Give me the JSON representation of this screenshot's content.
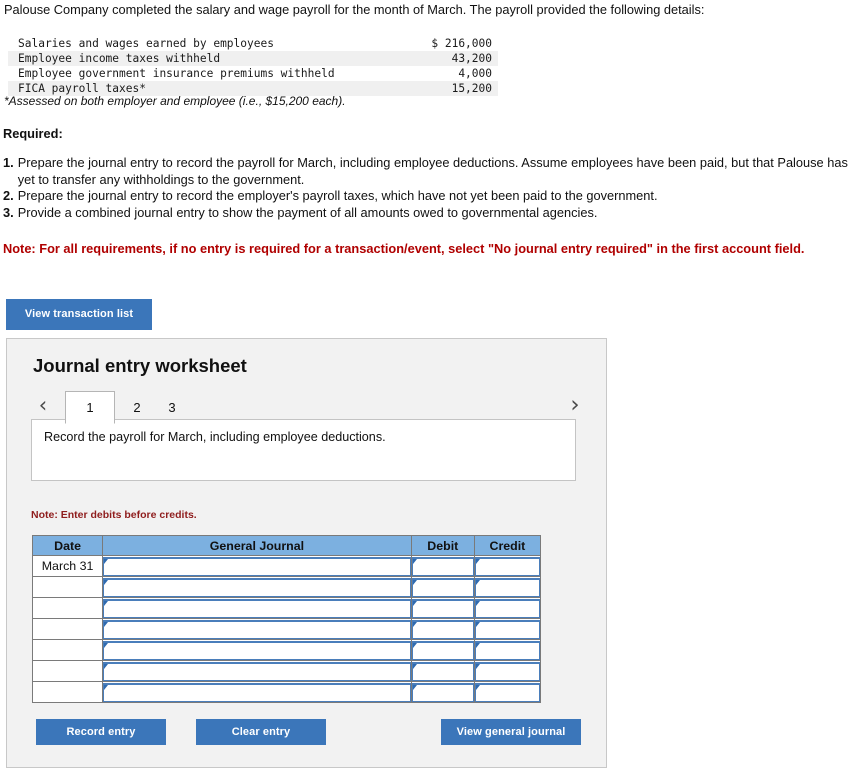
{
  "intro": "Palouse Company completed the salary and wage payroll for the month of March. The payroll provided the following details:",
  "payroll_details": {
    "rows": [
      {
        "label": "Salaries and wages earned by employees",
        "amount": "$ 216,000"
      },
      {
        "label": "Employee income taxes withheld",
        "amount": "43,200"
      },
      {
        "label": "Employee government insurance premiums withheld",
        "amount": "4,000"
      },
      {
        "label": "FICA payroll taxes*",
        "amount": "15,200"
      }
    ],
    "footnote": "*Assessed on both employer and employee (i.e., $15,200 each)."
  },
  "required": {
    "heading": "Required:",
    "items": [
      {
        "num": "1.",
        "text": "Prepare the journal entry to record the payroll for March, including employee deductions. Assume employees have been paid, but that Palouse has yet to transfer any withholdings to the government."
      },
      {
        "num": "2.",
        "text": "Prepare the journal entry to record the employer's payroll taxes, which have not yet been paid to the government."
      },
      {
        "num": "3.",
        "text": "Provide a combined journal entry to show the payment of all amounts owed to governmental agencies."
      }
    ],
    "note": "Note: For all requirements, if no entry is required for a transaction/event, select \"No journal entry required\" in the first account field."
  },
  "view_transaction_list_label": "View transaction list",
  "worksheet": {
    "title": "Journal entry worksheet",
    "prev_arrow": "‹",
    "next_arrow": "›",
    "tabs": [
      {
        "label": "1",
        "active": true
      },
      {
        "label": "2",
        "active": false
      },
      {
        "label": "3",
        "active": false
      }
    ],
    "instruction": "Record the payroll for March, including employee deductions.",
    "note_debits": "Note: Enter debits before credits.",
    "table": {
      "columns": [
        "Date",
        "General Journal",
        "Debit",
        "Credit"
      ],
      "rows": [
        {
          "date": "March 31",
          "general_journal": "",
          "debit": "",
          "credit": ""
        },
        {
          "date": "",
          "general_journal": "",
          "debit": "",
          "credit": ""
        },
        {
          "date": "",
          "general_journal": "",
          "debit": "",
          "credit": ""
        },
        {
          "date": "",
          "general_journal": "",
          "debit": "",
          "credit": ""
        },
        {
          "date": "",
          "general_journal": "",
          "debit": "",
          "credit": ""
        },
        {
          "date": "",
          "general_journal": "",
          "debit": "",
          "credit": ""
        },
        {
          "date": "",
          "general_journal": "",
          "debit": "",
          "credit": ""
        }
      ]
    },
    "buttons": {
      "record": "Record entry",
      "clear": "Clear entry",
      "view_general_journal": "View general journal"
    }
  },
  "colors": {
    "button_blue": "#3b76ba",
    "header_blue": "#7cb0e0",
    "input_border_blue": "#4a7ebb",
    "note_red": "#b00000",
    "panel_gray": "#f2f2f2"
  }
}
